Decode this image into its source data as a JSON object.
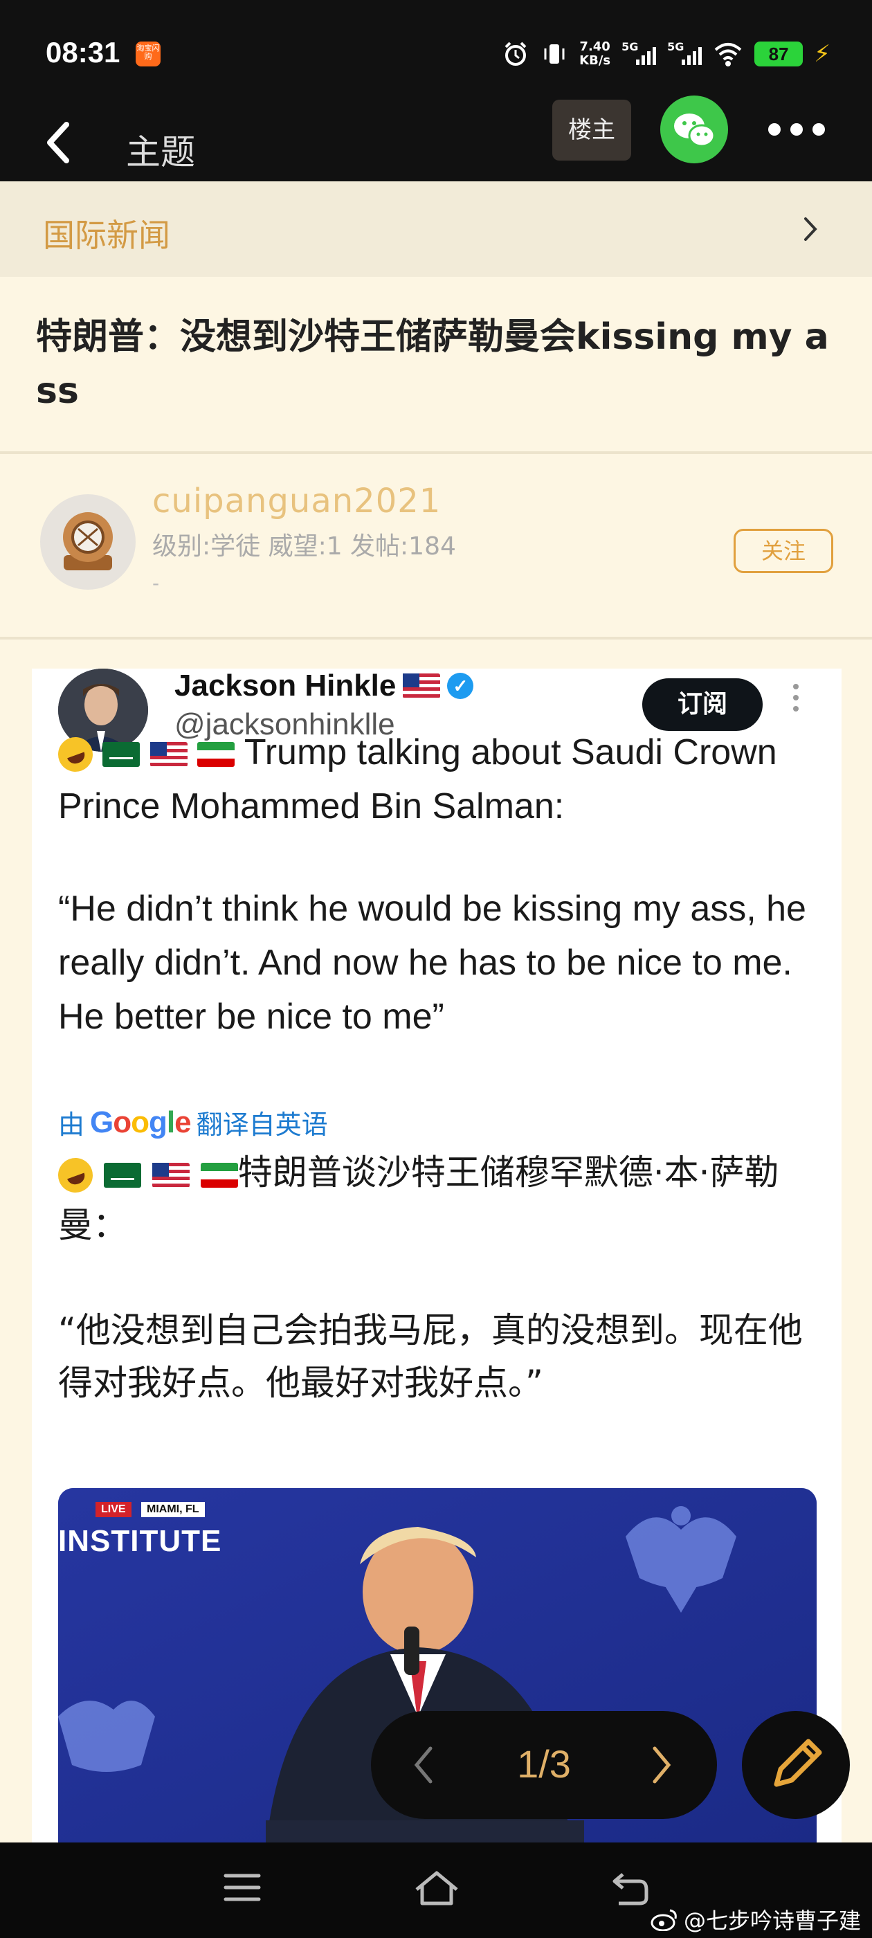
{
  "status_bar": {
    "time": "08:31",
    "app_badge": "淘宝闪购",
    "net_speed_top": "7.40",
    "net_speed_bottom": "KB/s",
    "signal1_label": "5G",
    "signal2_label": "5G",
    "battery": "87"
  },
  "header": {
    "title": "主题",
    "owner_label": "楼主"
  },
  "category": {
    "label": "国际新闻"
  },
  "post": {
    "title": "特朗普：没想到沙特王储萨勒曼会kissing my ass"
  },
  "author": {
    "name": "cuipanguan2021",
    "meta": "级别:学徒 威望:1 发帖:184",
    "signature": "-",
    "follow_label": "关注"
  },
  "tweet": {
    "name": "Jackson Hinkle",
    "handle": "@jacksonhinklle",
    "subscribe_label": "订阅",
    "text_en_intro": "Trump talking about Saudi Crown Prince Mohammed Bin Salman:",
    "text_en_quote": "“He didn’t think he would be kissing my ass, he really didn’t. And now he has to be nice to me. He better be nice to me”",
    "translate_prefix": "由",
    "translate_brand": "Google",
    "translate_suffix": "翻译自英语",
    "text_zh_intro": "特朗普谈沙特王储穆罕默德·本·萨勒曼：",
    "text_zh_quote": "“他没想到自己会拍我马屁，真的没想到。现在他得对我好点。他最好对我好点。”",
    "video_live": "LIVE",
    "video_location": "MIAMI, FL",
    "video_banner": "INSTITUTE"
  },
  "pager": {
    "text": "1/3"
  },
  "watermark": {
    "text": "@七步吟诗曹子建"
  },
  "colors": {
    "accent": "#e1a03e",
    "background": "#fdf6e3",
    "category_bar": "#f2ebd8",
    "wechat": "#3ec74a",
    "battery": "#2bd33a"
  }
}
